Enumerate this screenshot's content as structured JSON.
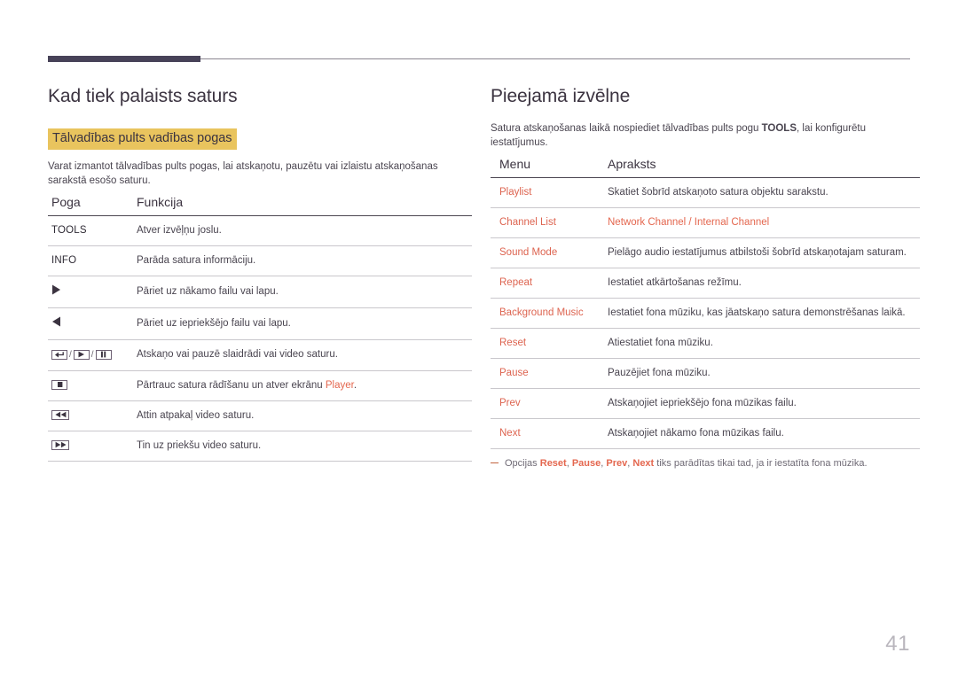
{
  "page": {
    "number": "41",
    "accent_color": "#e4674f",
    "highlight_color": "#e9c45e",
    "heading_color": "#3b3340",
    "rule_color": "#474258"
  },
  "left": {
    "title": "Kad tiek palaists saturs",
    "subheading": "Tālvadības pults vadības pogas",
    "intro": "Varat izmantot tālvadības pults pogas, lai atskaņotu, pauzētu vai izlaistu atskaņošanas sarakstā esošo saturu.",
    "table": {
      "headers": [
        "Poga",
        "Funkcija"
      ],
      "rows": [
        {
          "button_type": "text",
          "button": "TOOLS",
          "icons": [],
          "desc": "Atver izvēļņu joslu."
        },
        {
          "button_type": "text",
          "button": "INFO",
          "icons": [],
          "desc": "Parāda satura informāciju."
        },
        {
          "button_type": "icon",
          "button": "",
          "icons": [
            "triangle-right-icon"
          ],
          "desc": "Pāriet uz nākamo failu vai lapu."
        },
        {
          "button_type": "icon",
          "button": "",
          "icons": [
            "triangle-left-icon"
          ],
          "desc": "Pāriet uz iepriekšējo failu vai lapu."
        },
        {
          "button_type": "icon",
          "button": "",
          "icons": [
            "enter-key-icon",
            "play-key-icon",
            "pause-key-icon"
          ],
          "desc": "Atskaņo vai pauzē slaidrādi vai video saturu."
        },
        {
          "button_type": "icon",
          "button": "",
          "icons": [
            "stop-key-icon"
          ],
          "desc": "Pārtrauc satura rādīšanu un atver ekrānu ",
          "desc_accent": "Player",
          "desc_tail": "."
        },
        {
          "button_type": "icon",
          "button": "",
          "icons": [
            "rewind-key-icon"
          ],
          "desc": "Attin atpakaļ video saturu."
        },
        {
          "button_type": "icon",
          "button": "",
          "icons": [
            "fastforward-key-icon"
          ],
          "desc": "Tin uz priekšu video saturu."
        }
      ]
    }
  },
  "right": {
    "title": "Pieejamā izvēlne",
    "intro_before": "Satura atskaņošanas laikā nospiediet tālvadības pults pogu ",
    "intro_keyword": "TOOLS",
    "intro_after": ", lai konfigurētu iestatījumus.",
    "table": {
      "headers": [
        "Menu",
        "Apraksts"
      ],
      "rows": [
        {
          "menu": "Playlist",
          "desc": "Skatiet šobrīd atskaņoto satura objektu sarakstu.",
          "desc_is_accent": false
        },
        {
          "menu": "Channel List",
          "desc": "Network Channel / Internal Channel",
          "desc_is_accent": true
        },
        {
          "menu": "Sound Mode",
          "desc": "Pielāgo audio iestatījumus atbilstoši šobrīd atskaņotajam saturam.",
          "desc_is_accent": false
        },
        {
          "menu": "Repeat",
          "desc": "Iestatiet atkārtošanas režīmu.",
          "desc_is_accent": false
        },
        {
          "menu": "Background Music",
          "desc": "Iestatiet fona mūziku, kas jāatskaņo satura demonstrēšanas laikā.",
          "desc_is_accent": false
        },
        {
          "menu": "Reset",
          "desc": "Atiestatiet fona mūziku.",
          "desc_is_accent": false
        },
        {
          "menu": "Pause",
          "desc": "Pauzējiet fona mūziku.",
          "desc_is_accent": false
        },
        {
          "menu": "Prev",
          "desc": "Atskaņojiet iepriekšējo fona mūzikas failu.",
          "desc_is_accent": false
        },
        {
          "menu": "Next",
          "desc": "Atskaņojiet nākamo fona mūzikas failu.",
          "desc_is_accent": false
        }
      ]
    },
    "footnote": {
      "lead": "Opcijas ",
      "options": [
        "Reset",
        "Pause",
        "Prev",
        "Next"
      ],
      "tail": " tiks parādītas tikai tad, ja ir iestatīta fona mūzika."
    }
  }
}
